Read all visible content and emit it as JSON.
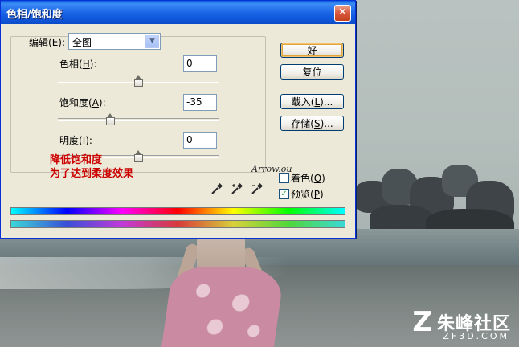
{
  "dialog": {
    "title": "色相/饱和度",
    "close_label": "✕",
    "edit": {
      "label": "编辑",
      "mnemonic": "E",
      "selected": "全图"
    },
    "hue": {
      "label": "色相",
      "mnemonic": "H",
      "value": "0",
      "slider_fraction": 0.5
    },
    "saturation": {
      "label": "饱和度",
      "mnemonic": "A",
      "value": "-35",
      "slider_fraction": 0.325
    },
    "lightness": {
      "label": "明度",
      "mnemonic": "I",
      "value": "0",
      "slider_fraction": 0.5
    },
    "buttons": {
      "ok": "好",
      "reset": "复位",
      "load": {
        "label": "载入",
        "mnemonic": "L",
        "suffix": "..."
      },
      "save": {
        "label": "存储",
        "mnemonic": "S",
        "suffix": "..."
      }
    },
    "colorize": {
      "label": "着色",
      "mnemonic": "O",
      "checked": false
    },
    "preview": {
      "label": "预览",
      "mnemonic": "P",
      "checked": true
    }
  },
  "annotation": {
    "line1": "降低饱和度",
    "line2": "为了达到柔度效果",
    "signature": "Arrow.ou"
  },
  "watermark": {
    "logo": "Z",
    "name": "朱峰社区",
    "sub": "ZF3D.COM"
  },
  "colors": {
    "annotation": "#cc0000",
    "title_bar": "#0a5bd8",
    "check": "#21a121"
  }
}
